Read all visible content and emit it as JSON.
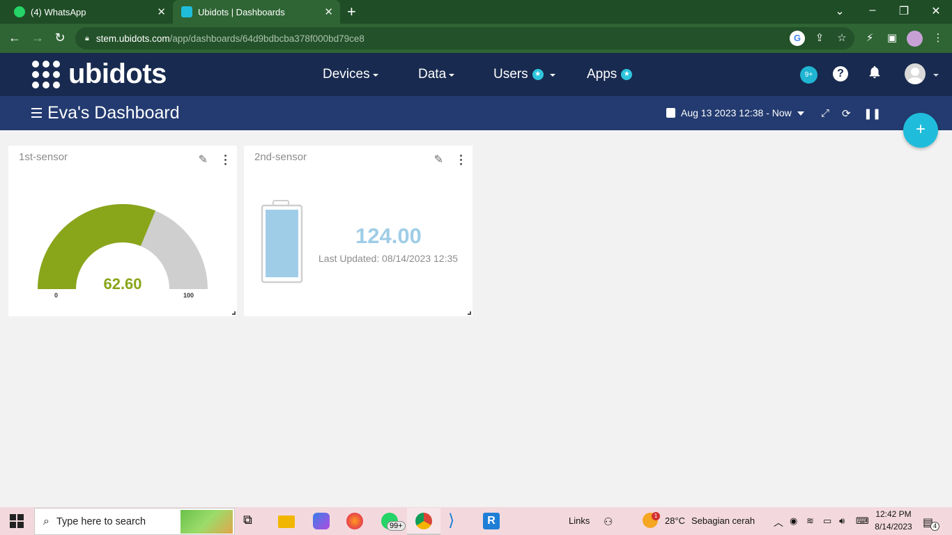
{
  "browser": {
    "tabs": [
      {
        "title": "(4) WhatsApp"
      },
      {
        "title": "Ubidots | Dashboards"
      }
    ],
    "url_host": "stem.ubidots.com",
    "url_path": "/app/dashboards/64d9bdbcba378f000bd79ce8"
  },
  "header": {
    "logo": "ubidots",
    "menu": [
      "Devices",
      "Data",
      "Users",
      "Apps"
    ],
    "notifications_badge": "9+",
    "help_label": "?"
  },
  "dashboard": {
    "title": "Eva's Dashboard",
    "date_range": "Aug 13 2023 12:38 - Now",
    "add_button": "+"
  },
  "widgets": [
    {
      "title": "1st-sensor",
      "type": "gauge",
      "value": "62.60",
      "min": "0",
      "max": "100",
      "fraction": 0.626,
      "color": "#89a51a"
    },
    {
      "title": "2nd-sensor",
      "type": "battery",
      "value": "124.00",
      "last_updated": "Last Updated: 08/14/2023 12:35",
      "color": "#9fcde7"
    }
  ],
  "taskbar": {
    "search_placeholder": "Type here to search",
    "links_label": "Links",
    "whatsapp_badge": "99+",
    "weather_temp": "28°C",
    "weather_desc": "Sebagian cerah",
    "weather_alert": "1",
    "time": "12:42 PM",
    "date": "8/14/2023",
    "notif_count": "4"
  }
}
